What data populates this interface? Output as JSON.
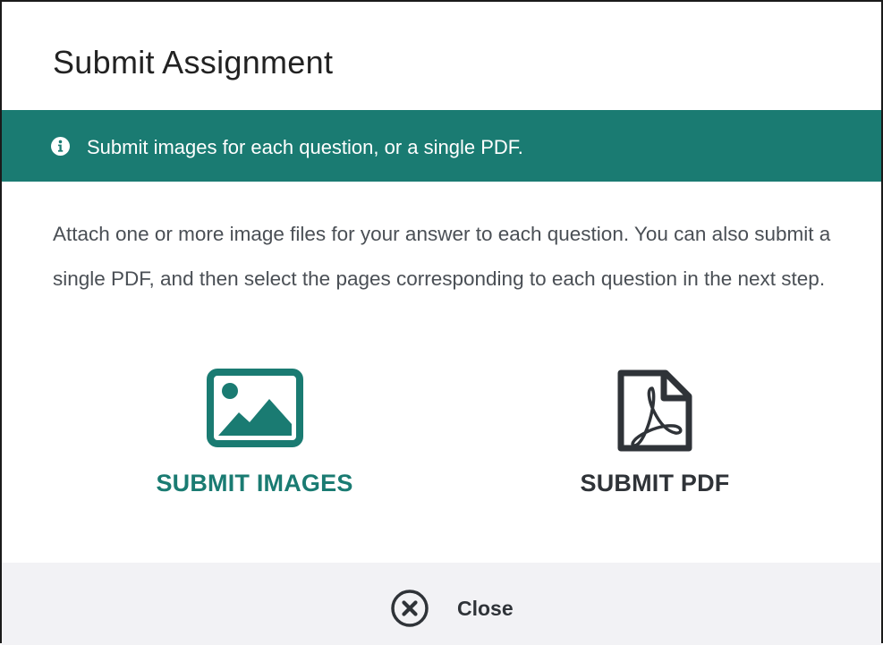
{
  "dialog": {
    "title": "Submit Assignment"
  },
  "banner": {
    "icon": "info-icon",
    "text": "Submit images for each question, or a single PDF."
  },
  "description": "Attach one or more image files for your answer to each question. You can also submit a single PDF, and then select the pages corresponding to each question in the next step.",
  "options": {
    "images": {
      "label": "SUBMIT IMAGES",
      "icon": "image-icon",
      "color": "#1a7b72"
    },
    "pdf": {
      "label": "SUBMIT PDF",
      "icon": "pdf-file-icon",
      "color": "#2f3338"
    }
  },
  "footer": {
    "close_label": "Close",
    "close_icon": "close-circle-icon",
    "background": "#f2f2f5"
  },
  "colors": {
    "accent": "#1a7b72",
    "text": "#4a4f55"
  }
}
